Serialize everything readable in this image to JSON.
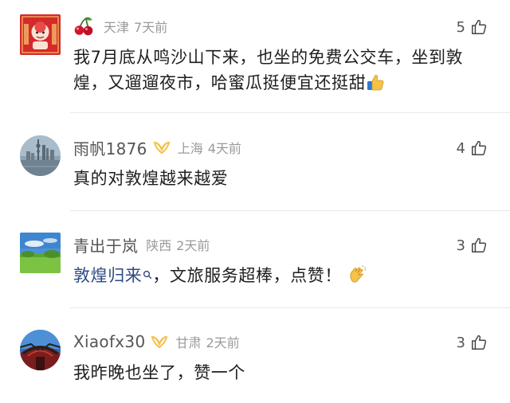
{
  "comments": [
    {
      "user": "",
      "location": "天津",
      "time": "7天前",
      "likes": "5",
      "text": "我7月底从鸣沙山下来，也坐的免费公交车，坐到敦煌，又遛遛夜市，哈蜜瓜挺便宜还挺甜",
      "user_emoji": "cherry-emoji",
      "trailing_emoji": "thumbs-up-emoji"
    },
    {
      "user": "雨帆1876",
      "location": "上海",
      "time": "4天前",
      "likes": "4",
      "text": "真的对敦煌越来越爱",
      "badge": "vip-badge-icon"
    },
    {
      "user": "青出于岚",
      "location": "陕西",
      "time": "2天前",
      "likes": "3",
      "topic": "敦煌归来",
      "text": "，文旅服务超棒，点赞！",
      "trailing_emoji": "clapping-hands-emoji"
    },
    {
      "user": "Xiaofx30",
      "location": "甘肃",
      "time": "2天前",
      "likes": "3",
      "text": "我昨晚也坐了，赞一个",
      "badge": "vip-badge-icon"
    }
  ],
  "colors": {
    "name": "#555555",
    "meta": "#9a9a9a",
    "text": "#1e1e1e",
    "topic_link": "#2e4a82",
    "badge": "#f2c14b",
    "divider": "#e9e9e9"
  }
}
